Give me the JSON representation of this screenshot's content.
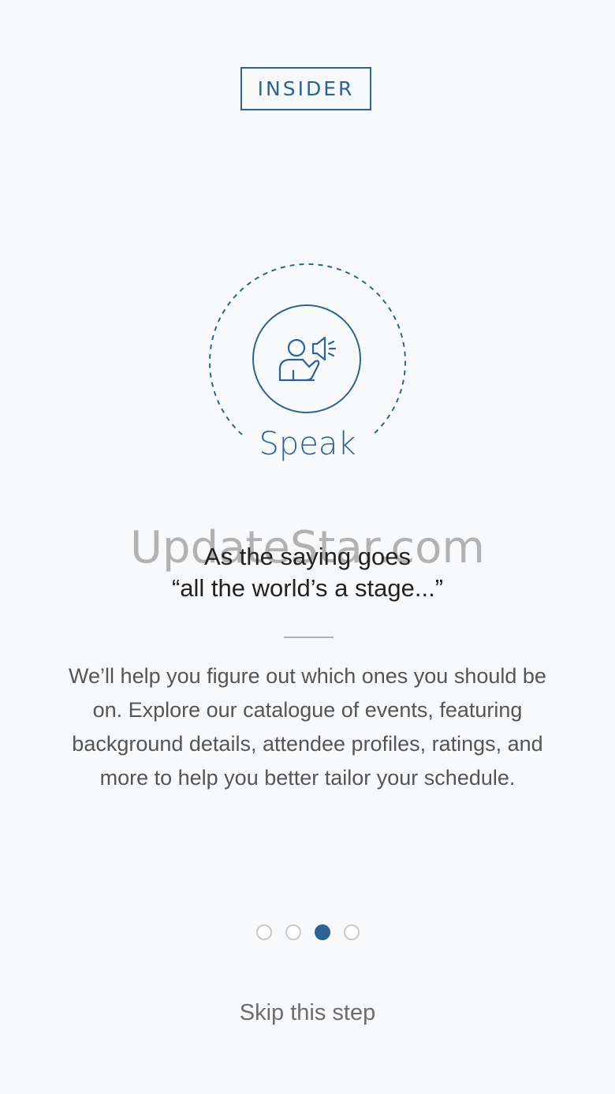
{
  "brand": {
    "logo_text": "INSIDER",
    "accent_color": "#2d6296"
  },
  "feature": {
    "icon": "speaker-megaphone-icon",
    "label": "Speak"
  },
  "watermark": "UpdateStar.com",
  "quote": {
    "line1": "As the saying goes",
    "line2": "“all the world’s a stage...”"
  },
  "description": "We’ll help you figure out which ones you should be on. Explore our catalogue of events, featuring background details, attendee profiles, ratings, and more to help you better tailor your schedule.",
  "pager": {
    "total": 4,
    "active_index": 2
  },
  "actions": {
    "skip_label": "Skip this step"
  }
}
